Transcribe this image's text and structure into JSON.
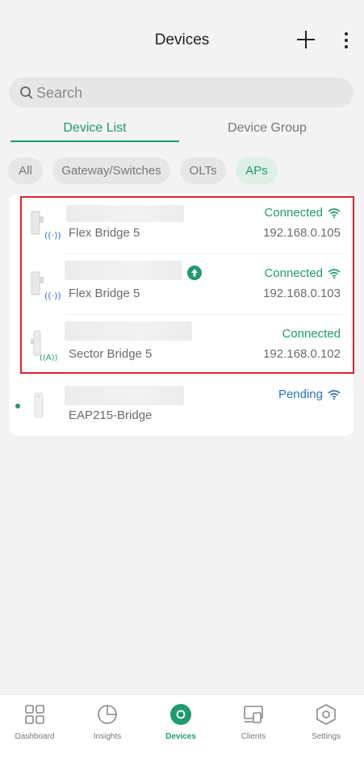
{
  "header": {
    "title": "Devices",
    "add_icon": "plus-icon",
    "more_icon": "more-vertical-icon"
  },
  "search": {
    "placeholder": "Search",
    "icon": "search-icon"
  },
  "tabs": [
    {
      "label": "Device List",
      "active": true
    },
    {
      "label": "Device Group",
      "active": false
    }
  ],
  "filters": [
    {
      "label": "All",
      "active": false
    },
    {
      "label": "Gateway/Switches",
      "active": false
    },
    {
      "label": "OLTs",
      "active": false
    },
    {
      "label": "APs",
      "active": true
    }
  ],
  "devices": [
    {
      "model": "Flex Bridge 5",
      "status": "Connected",
      "ip": "192.168.0.105",
      "wifi": true,
      "upgrade": false
    },
    {
      "model": "Flex Bridge 5",
      "status": "Connected",
      "ip": "192.168.0.103",
      "wifi": true,
      "upgrade": true
    },
    {
      "model": "Sector Bridge 5",
      "status": "Connected",
      "ip": "192.168.0.102",
      "wifi": false,
      "upgrade": false
    },
    {
      "model": "EAP215-Bridge",
      "status": "Pending",
      "ip": "",
      "wifi": true,
      "upgrade": false
    }
  ],
  "bottom_nav": [
    {
      "label": "Dashboard",
      "icon": "dashboard-icon",
      "active": false
    },
    {
      "label": "Insights",
      "icon": "insights-pie-icon",
      "active": false
    },
    {
      "label": "Devices",
      "icon": "devices-icon",
      "active": true
    },
    {
      "label": "Clients",
      "icon": "clients-icon",
      "active": false
    },
    {
      "label": "Settings",
      "icon": "settings-hexagon-icon",
      "active": false
    }
  ],
  "colors": {
    "accent": "#1f9a6e",
    "pending": "#2d6fbf",
    "highlight": "#e0202b"
  }
}
